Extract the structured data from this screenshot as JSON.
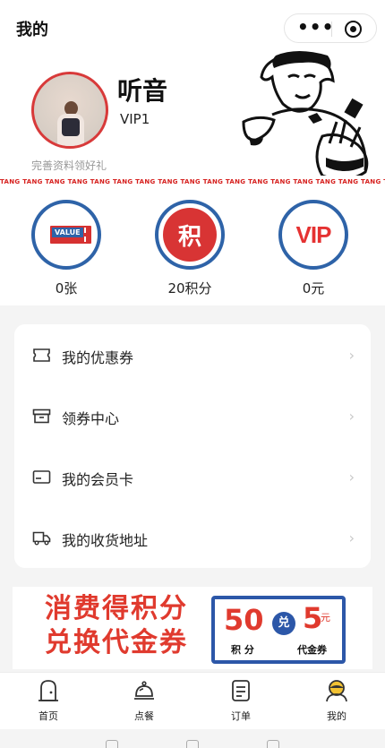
{
  "navbar": {
    "title": "我的",
    "more_icon": "more-dots-icon",
    "close_icon": "target-circle-icon"
  },
  "profile": {
    "name": "听音",
    "level": "VIP1",
    "tip": "完善资料领好礼",
    "strip_text": "TANG TANG TANG TANG TANG TANG TANG TANG TANG TANG TANG TANG TANG TANG TANG TANG TANG TANG TANG TANG TANG TANG"
  },
  "stats": [
    {
      "icon": "value-ticket-icon",
      "badge": "VALUE",
      "value": "0张"
    },
    {
      "icon": "points-icon",
      "badge": "积",
      "value": "20积分"
    },
    {
      "icon": "vip-icon",
      "badge": "VIP",
      "value": "0元"
    }
  ],
  "menu": [
    {
      "icon": "coupon-icon",
      "label": "我的优惠券"
    },
    {
      "icon": "box-icon",
      "label": "领券中心"
    },
    {
      "icon": "card-icon",
      "label": "我的会员卡"
    },
    {
      "icon": "truck-icon",
      "label": "我的收货地址"
    }
  ],
  "banner": {
    "line1": "消费得积分",
    "line2": "兑换代金券",
    "coupon_points": "50",
    "coupon_exchange": "兑",
    "coupon_cash": "5",
    "coupon_unit": "元",
    "coupon_points_label": "积 分",
    "coupon_cash_label": "代金券"
  },
  "tabbar": [
    {
      "icon": "home-door-icon",
      "label": "首页"
    },
    {
      "icon": "cloche-icon",
      "label": "点餐"
    },
    {
      "icon": "order-list-icon",
      "label": "订单"
    },
    {
      "icon": "profile-face-icon",
      "label": "我的"
    }
  ],
  "colors": {
    "accent_red": "#e03a2e",
    "accent_blue": "#2e63a8"
  }
}
